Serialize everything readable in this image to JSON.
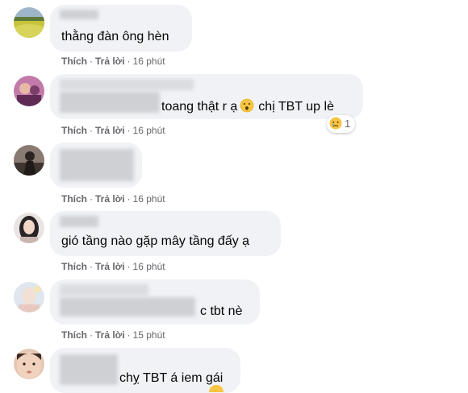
{
  "actions": {
    "like_label": "Thích",
    "reply_label": "Trả lời",
    "separator": "·"
  },
  "comments": [
    {
      "text": "thằng đàn ông hèn",
      "time": "16 phút",
      "avatar_icon": "field-landscape-avatar"
    },
    {
      "text_before_emoji": "toang thật r ạ",
      "emoji": "surprised-face-emoji",
      "text_after_emoji": "chị TBT up lè",
      "time": "16 phút",
      "reaction_emoji": "sad-face-emoji",
      "reaction_count": "1",
      "avatar_icon": "pink-portrait-avatar"
    },
    {
      "text": "",
      "time": "16 phút",
      "avatar_icon": "dark-silhouette-avatar"
    },
    {
      "text": "gió tầng nào gặp mây tầng đấy ạ",
      "time": "16 phút",
      "avatar_icon": "girl-portrait-avatar"
    },
    {
      "text": "c tbt nè",
      "time": "15 phút",
      "avatar_icon": "light-portrait-avatar"
    },
    {
      "text": "chỵ TBT á iem gái",
      "time": "",
      "avatar_icon": "face-closeup-avatar"
    }
  ],
  "colors": {
    "bubble": "#f0f2f5",
    "meta_text": "#65676b",
    "comment_text": "#050505",
    "emoji_yellow": "#f7c542"
  }
}
